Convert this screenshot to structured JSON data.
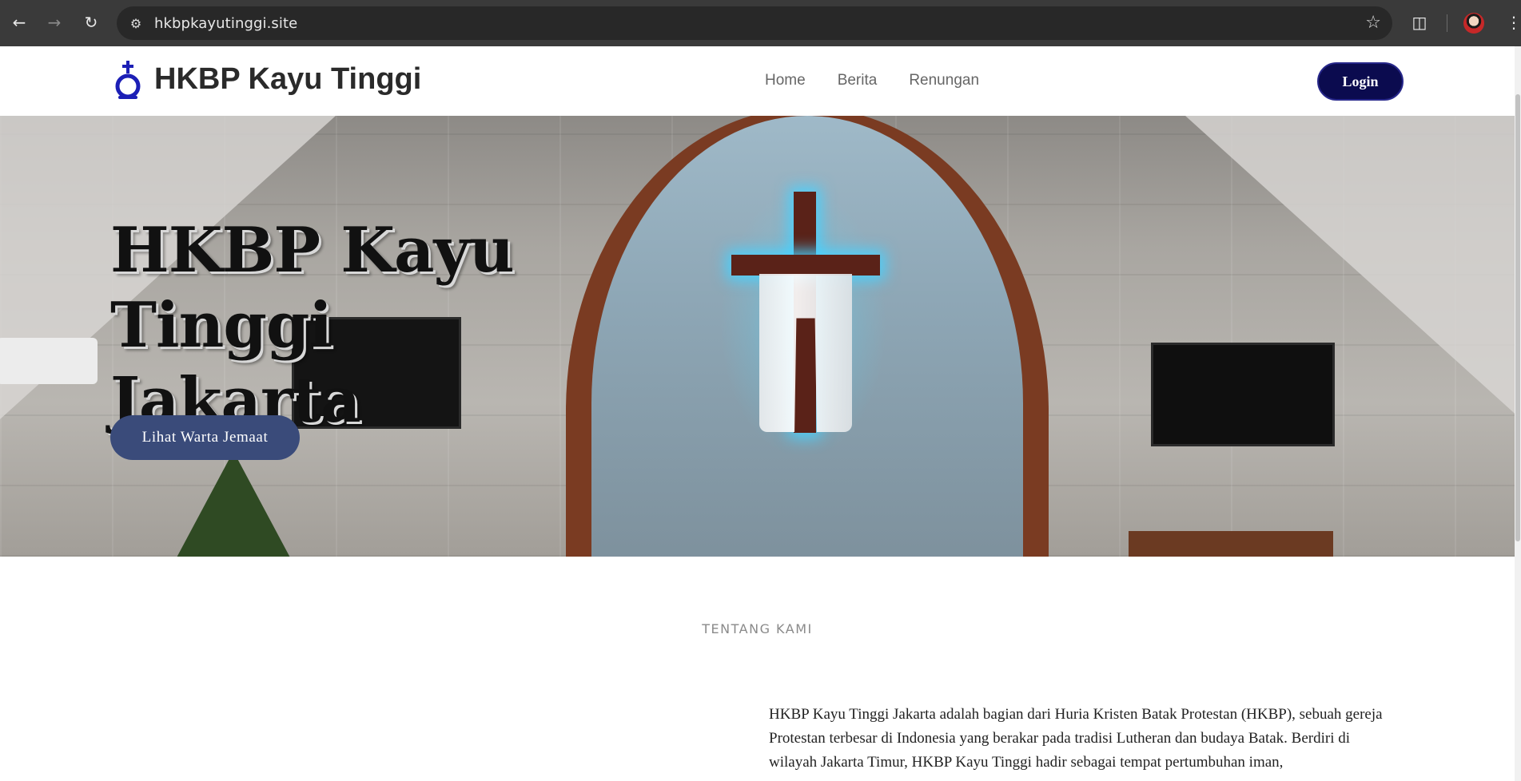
{
  "browser": {
    "url": "hkbpkayutinggi.site",
    "icons": {
      "back": "arrow-left-icon",
      "forward": "arrow-right-icon",
      "reload": "reload-icon",
      "site_info": "tune-icon",
      "bookmark": "star-icon",
      "extensions": "puzzle-icon",
      "menu": "kebab-menu-icon"
    }
  },
  "header": {
    "brand": "HKBP Kayu Tinggi",
    "logo": "hkbp-logo-icon",
    "nav": [
      "Home",
      "Berita",
      "Renungan"
    ],
    "login_label": "Login",
    "colors": {
      "login_bg": "#0b0b4f",
      "logo": "#1c1fb6"
    }
  },
  "hero": {
    "title": "HKBP Kayu Tinggi Jakarta",
    "cta_label": "Lihat Warta Jemaat",
    "colors": {
      "cta_bg": "#3a4b7a"
    }
  },
  "about": {
    "section_label": "TENTANG KAMI",
    "paragraph": "HKBP Kayu Tinggi Jakarta adalah bagian dari Huria Kristen Batak Protestan (HKBP), sebuah gereja Protestan terbesar di Indonesia yang berakar pada tradisi Lutheran dan budaya Batak. Berdiri di wilayah Jakarta Timur, HKBP Kayu Tinggi hadir sebagai tempat pertumbuhan iman,"
  }
}
